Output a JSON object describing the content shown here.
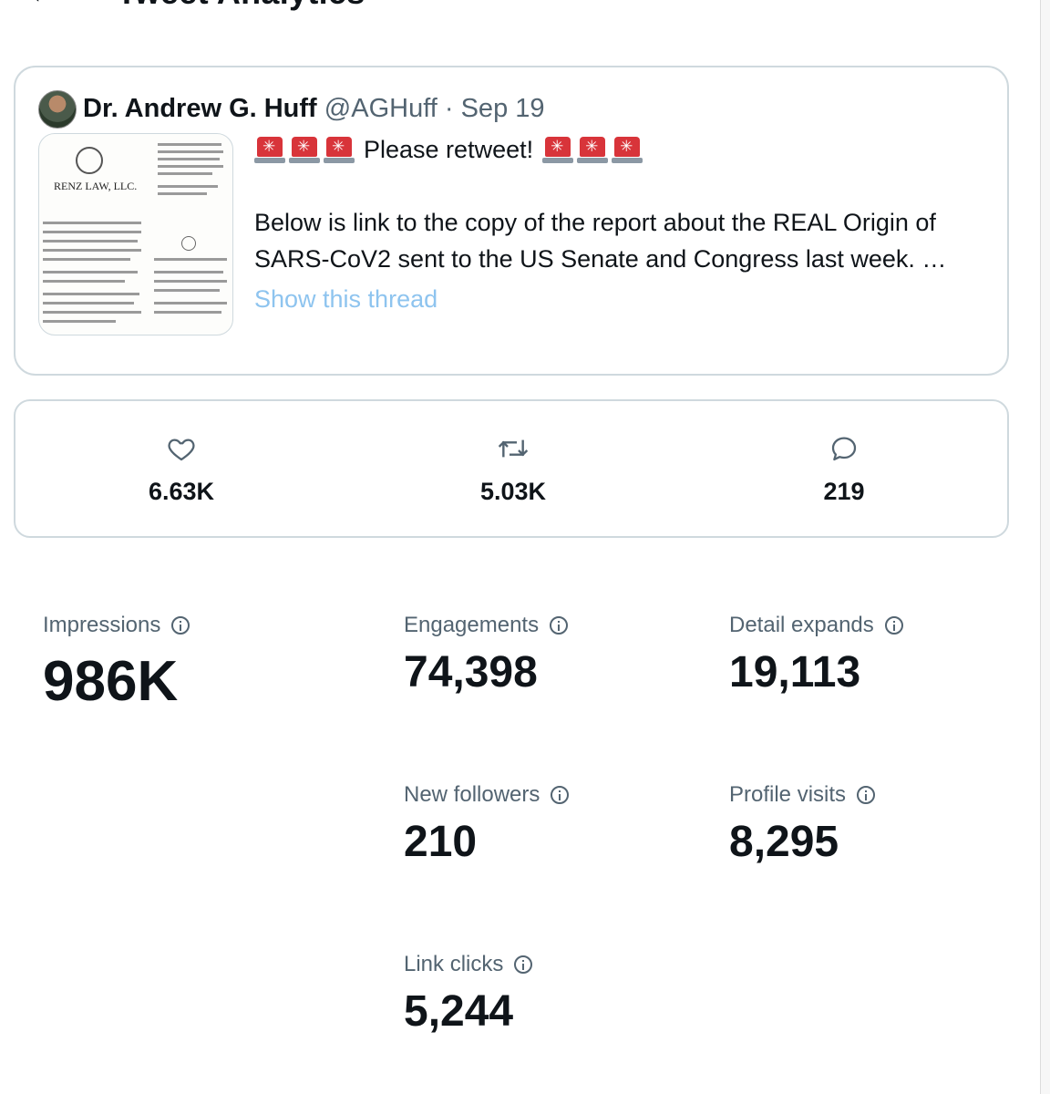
{
  "header": {
    "title": "Tweet Analytics"
  },
  "tweet": {
    "author_name": "Dr. Andrew G. Huff",
    "handle": "@AGHuff",
    "separator": "·",
    "date": "Sep 19",
    "line1_text": "Please retweet!",
    "body": "Below is link to the copy of the report about the REAL Origin of SARS-CoV2 sent to the US Senate and Congress last week. …",
    "show_thread": "Show this thread",
    "image_doc_title": "RENZ LAW, LLC."
  },
  "engagement": {
    "likes": "6.63K",
    "retweets": "5.03K",
    "replies": "219"
  },
  "metrics": {
    "impressions": {
      "label": "Impressions",
      "value": "986K"
    },
    "engagements": {
      "label": "Engagements",
      "value": "74,398"
    },
    "detail_expands": {
      "label": "Detail expands",
      "value": "19,113"
    },
    "new_followers": {
      "label": "New followers",
      "value": "210"
    },
    "profile_visits": {
      "label": "Profile visits",
      "value": "8,295"
    },
    "link_clicks": {
      "label": "Link clicks",
      "value": "5,244"
    }
  },
  "icons": {
    "like": "heart-icon",
    "retweet": "retweet-icon",
    "reply": "reply-icon",
    "info": "info-icon",
    "siren": "police-light-emoji"
  },
  "colors": {
    "text_primary": "#0f1419",
    "text_secondary": "#536471",
    "link": "#8ec4ef",
    "border": "#cfd9de",
    "siren_red": "#d8343a"
  }
}
